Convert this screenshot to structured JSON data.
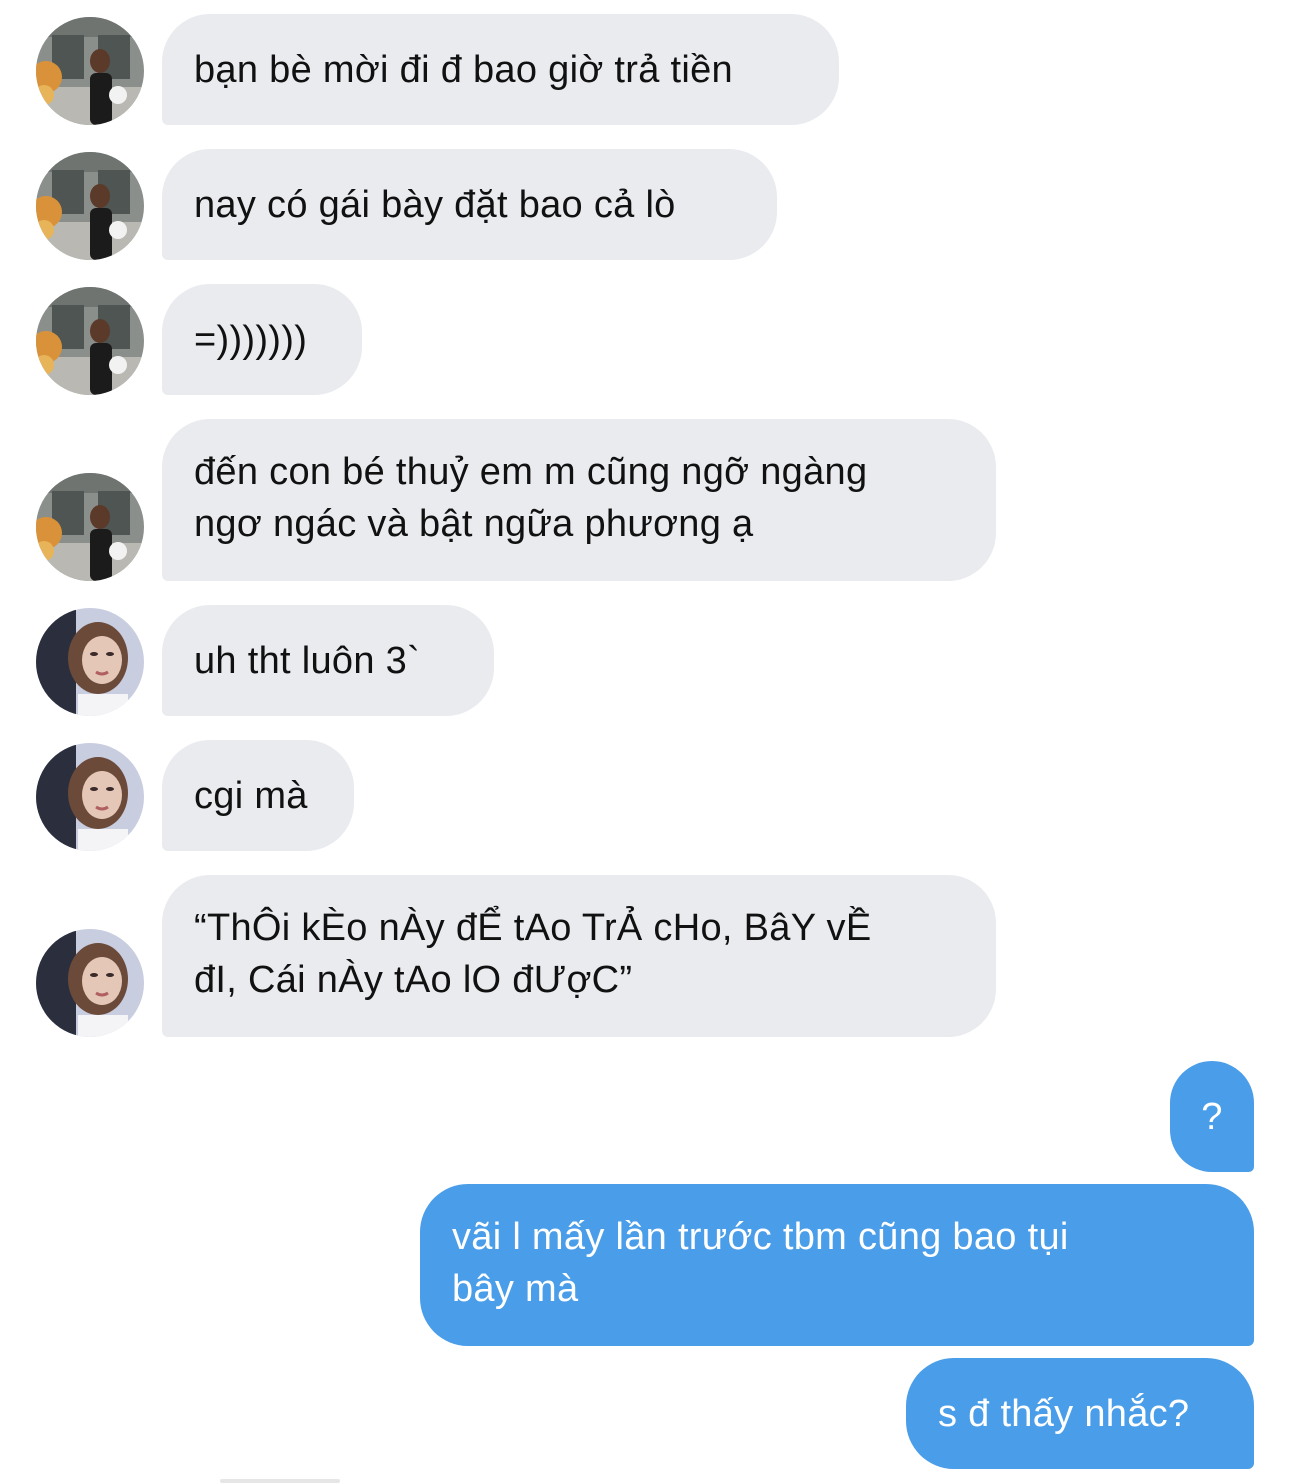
{
  "conversation": {
    "messages": [
      {
        "sender": "contact_a",
        "text": "bạn bè mời đi đ bao giờ trả tiền"
      },
      {
        "sender": "contact_a",
        "text": "nay có gái bày đặt bao cả lò"
      },
      {
        "sender": "contact_a",
        "text": "=)))))))"
      },
      {
        "sender": "contact_a",
        "lines": [
          "đến con bé thuỷ em m cũng ngỡ ngàng",
          "ngơ ngác và bật ngữa phương ạ"
        ]
      },
      {
        "sender": "contact_b",
        "text": "uh tht luôn 3`"
      },
      {
        "sender": "contact_b",
        "text": "cgi mà"
      },
      {
        "sender": "contact_b",
        "lines": [
          "“ThÔi kÈo nÀy đỂ tAo TrẢ cHo, BâY vỀ",
          "đI, Cái nÀy tAo lO đƯợC”"
        ]
      },
      {
        "sender": "me",
        "text": "?"
      },
      {
        "sender": "me",
        "lines": [
          "vãi l mấy lần trước tbm cũng bao tụi",
          "bây mà"
        ]
      },
      {
        "sender": "me",
        "text": "s đ thấy nhắc?"
      }
    ]
  },
  "colors": {
    "incoming_bubble": "#e9ebef",
    "outgoing_bubble": "#4a9de8",
    "incoming_text": "#111111",
    "outgoing_text": "#ffffff"
  },
  "icons": {
    "contact_a_avatar": "avatar-photo-storefront",
    "contact_b_avatar": "avatar-photo-portrait"
  }
}
